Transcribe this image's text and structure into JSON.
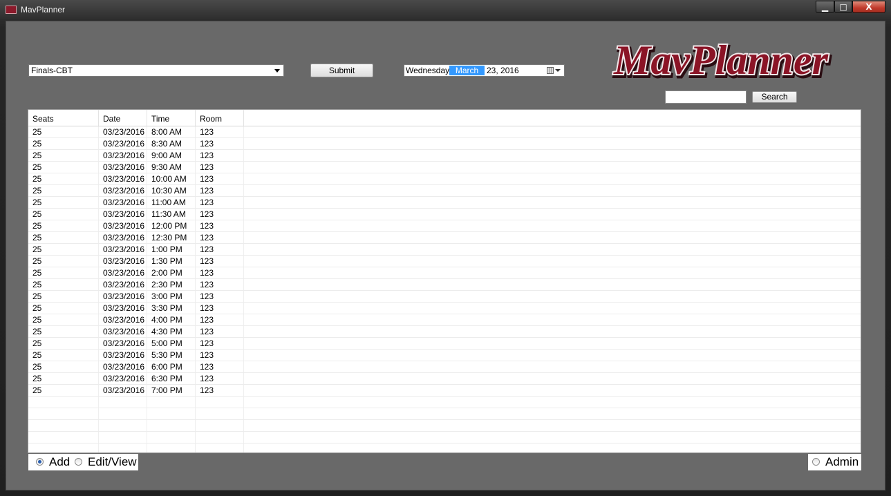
{
  "window": {
    "title": "MavPlanner",
    "controls": {
      "minimize": "▁",
      "maximize": "□",
      "close": "X"
    }
  },
  "toolbar": {
    "course_combo": {
      "value": "Finals-CBT"
    },
    "submit_label": "Submit",
    "date": {
      "day": "Wednesday,",
      "month": "March",
      "rest": "23, 2016"
    }
  },
  "logo": {
    "text": "MavPlanner"
  },
  "search": {
    "value": "",
    "button_label": "Search"
  },
  "table": {
    "columns": [
      "Seats",
      "Date",
      "Time",
      "Room"
    ],
    "rows": [
      [
        "25",
        "03/23/2016",
        "8:00 AM",
        "123"
      ],
      [
        "25",
        "03/23/2016",
        "8:30 AM",
        "123"
      ],
      [
        "25",
        "03/23/2016",
        "9:00 AM",
        "123"
      ],
      [
        "25",
        "03/23/2016",
        "9:30 AM",
        "123"
      ],
      [
        "25",
        "03/23/2016",
        "10:00 AM",
        "123"
      ],
      [
        "25",
        "03/23/2016",
        "10:30 AM",
        "123"
      ],
      [
        "25",
        "03/23/2016",
        "11:00 AM",
        "123"
      ],
      [
        "25",
        "03/23/2016",
        "11:30 AM",
        "123"
      ],
      [
        "25",
        "03/23/2016",
        "12:00 PM",
        "123"
      ],
      [
        "25",
        "03/23/2016",
        "12:30 PM",
        "123"
      ],
      [
        "25",
        "03/23/2016",
        "1:00 PM",
        "123"
      ],
      [
        "25",
        "03/23/2016",
        "1:30 PM",
        "123"
      ],
      [
        "25",
        "03/23/2016",
        "2:00 PM",
        "123"
      ],
      [
        "25",
        "03/23/2016",
        "2:30 PM",
        "123"
      ],
      [
        "25",
        "03/23/2016",
        "3:00 PM",
        "123"
      ],
      [
        "25",
        "03/23/2016",
        "3:30 PM",
        "123"
      ],
      [
        "25",
        "03/23/2016",
        "4:00 PM",
        "123"
      ],
      [
        "25",
        "03/23/2016",
        "4:30 PM",
        "123"
      ],
      [
        "25",
        "03/23/2016",
        "5:00 PM",
        "123"
      ],
      [
        "25",
        "03/23/2016",
        "5:30 PM",
        "123"
      ],
      [
        "25",
        "03/23/2016",
        "6:00 PM",
        "123"
      ],
      [
        "25",
        "03/23/2016",
        "6:30 PM",
        "123"
      ],
      [
        "25",
        "03/23/2016",
        "7:00 PM",
        "123"
      ]
    ]
  },
  "modes": {
    "add": {
      "label": "Add",
      "checked": true
    },
    "edit": {
      "label": "Edit/View",
      "checked": false
    },
    "admin": {
      "label": "Admin",
      "checked": false
    }
  },
  "colors": {
    "client_bg": "#696969",
    "logo_red": "#8b1426",
    "selection_blue": "#3399ff"
  }
}
